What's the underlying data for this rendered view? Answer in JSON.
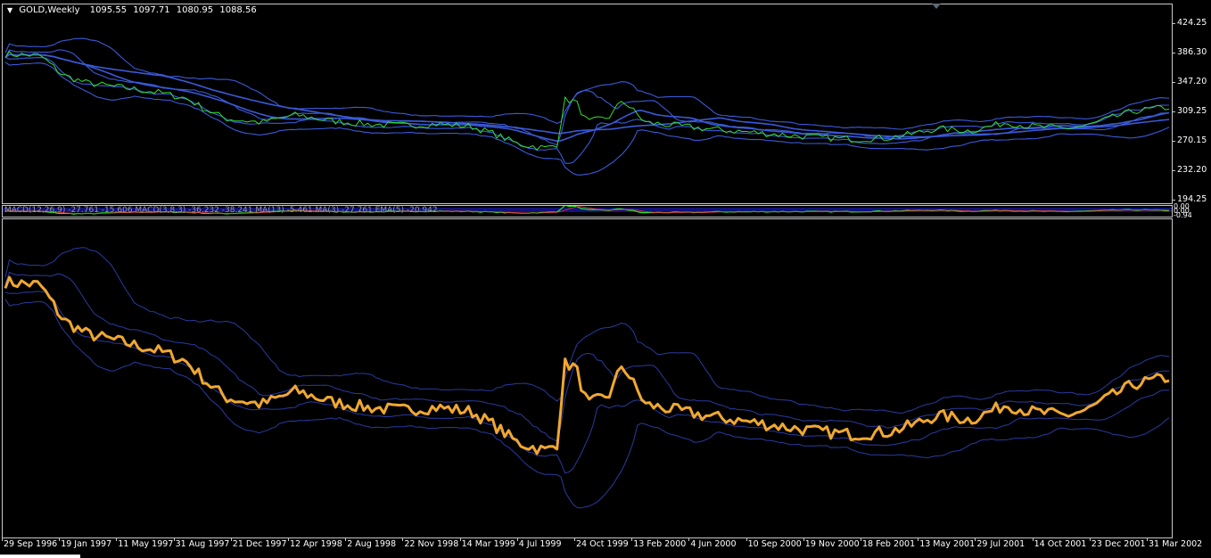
{
  "header": {
    "symbol": "GOLD,Weekly",
    "open": "1095.55",
    "high": "1097.71",
    "low": "1080.95",
    "close": "1088.56"
  },
  "main_yaxis": [
    "424.25",
    "386.30",
    "347.20",
    "309.25",
    "270.15",
    "232.20",
    "194.25"
  ],
  "macd": {
    "label": "MACD(12,26,9) -27.761 -15.606 MACD(3,8,3) -36.232 -38.241 MA(13) -5.461 MA(3) -27.761 EMA(5) -20.942",
    "right_values": [
      "0.00",
      "0.00",
      "-0.94"
    ]
  },
  "xaxis": [
    "29 Sep 1996",
    "19 Jan 1997",
    "11 May 1997",
    "31 Aug 1997",
    "21 Dec 1997",
    "12 Apr 1998",
    "2 Aug 1998",
    "22 Nov 1998",
    "14 Mar 1999",
    "4 Jul 1999",
    "24 Oct 1999",
    "13 Feb 2000",
    "4 Jun 2000",
    "10 Sep 2000",
    "19 Nov 2000",
    "18 Feb 2001",
    "13 May 2001",
    "29 Jul 2001",
    "14 Oct 2001",
    "23 Dec 2001",
    "31 Mar 2002"
  ],
  "colors": {
    "background": "#000000",
    "price_line": "#33dd33",
    "envelope": "#3a5ad8",
    "lower_price": "#f0a830",
    "lower_env": "#2a3aa0"
  },
  "chart_data": {
    "type": "line",
    "price_key_points": [
      [
        0,
        380
      ],
      [
        0.03,
        378
      ],
      [
        0.05,
        352
      ],
      [
        0.07,
        342
      ],
      [
        0.1,
        336
      ],
      [
        0.13,
        330
      ],
      [
        0.155,
        322
      ],
      [
        0.175,
        305
      ],
      [
        0.19,
        295
      ],
      [
        0.22,
        290
      ],
      [
        0.25,
        300
      ],
      [
        0.28,
        292
      ],
      [
        0.31,
        288
      ],
      [
        0.34,
        286
      ],
      [
        0.37,
        288
      ],
      [
        0.4,
        285
      ],
      [
        0.42,
        275
      ],
      [
        0.44,
        262
      ],
      [
        0.465,
        256
      ],
      [
        0.475,
        262
      ],
      [
        0.48,
        320
      ],
      [
        0.49,
        318
      ],
      [
        0.5,
        290
      ],
      [
        0.52,
        298
      ],
      [
        0.53,
        320
      ],
      [
        0.55,
        290
      ],
      [
        0.6,
        282
      ],
      [
        0.65,
        276
      ],
      [
        0.7,
        270
      ],
      [
        0.73,
        268
      ],
      [
        0.76,
        270
      ],
      [
        0.78,
        275
      ],
      [
        0.8,
        282
      ],
      [
        0.83,
        279
      ],
      [
        0.86,
        290
      ],
      [
        0.88,
        285
      ],
      [
        0.91,
        282
      ],
      [
        0.93,
        286
      ],
      [
        0.95,
        296
      ],
      [
        0.97,
        305
      ],
      [
        1,
        310
      ]
    ],
    "ylim": [
      194.25,
      424.25
    ]
  }
}
